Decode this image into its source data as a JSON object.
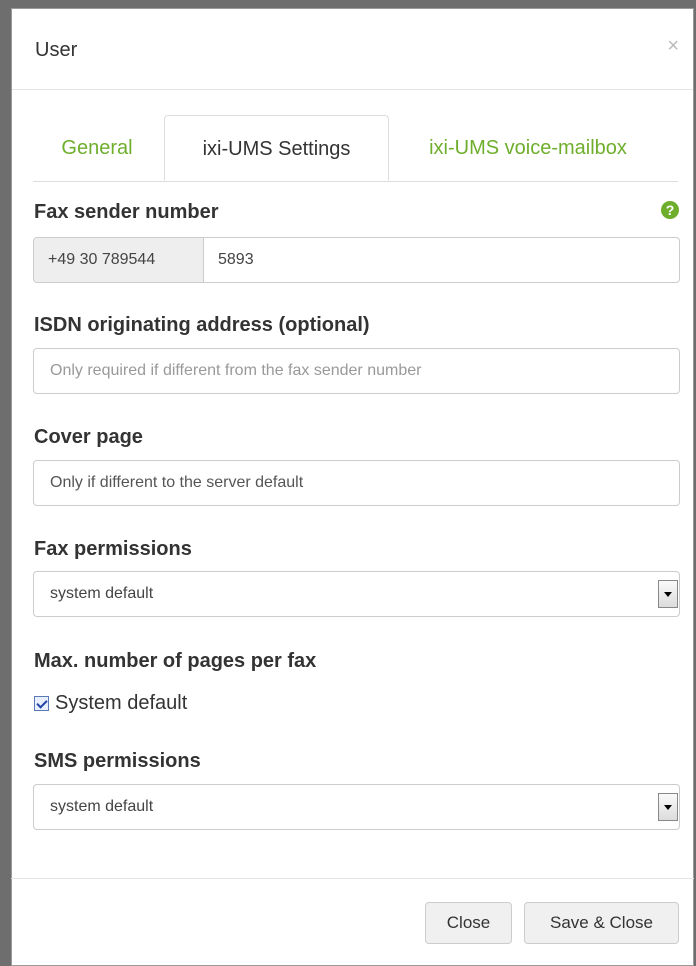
{
  "dialog": {
    "title": "User",
    "close_symbol": "×"
  },
  "tabs": [
    {
      "label": "General",
      "active": false
    },
    {
      "label": "ixi-UMS Settings",
      "active": true
    },
    {
      "label": "ixi-UMS voice-mailbox",
      "active": false
    }
  ],
  "fax_sender": {
    "label": "Fax sender number",
    "help_icon": "?",
    "prefix": "+49 30 789544",
    "value": "5893"
  },
  "isdn": {
    "label": "ISDN originating address (optional)",
    "placeholder": "Only required if different from the fax sender number"
  },
  "cover_page": {
    "label": "Cover page",
    "value": "Only if different to the server default"
  },
  "fax_permissions": {
    "label": "Fax permissions",
    "selected": "system default"
  },
  "max_pages": {
    "label": "Max. number of pages per fax",
    "checkbox_label": "System default",
    "checked": true
  },
  "sms_permissions": {
    "label": "SMS permissions",
    "selected": "system default"
  },
  "footer": {
    "close_label": "Close",
    "save_close_label": "Save & Close"
  },
  "colors": {
    "accent_green": "#6fae2c",
    "overlay": "#6e6e6e"
  }
}
